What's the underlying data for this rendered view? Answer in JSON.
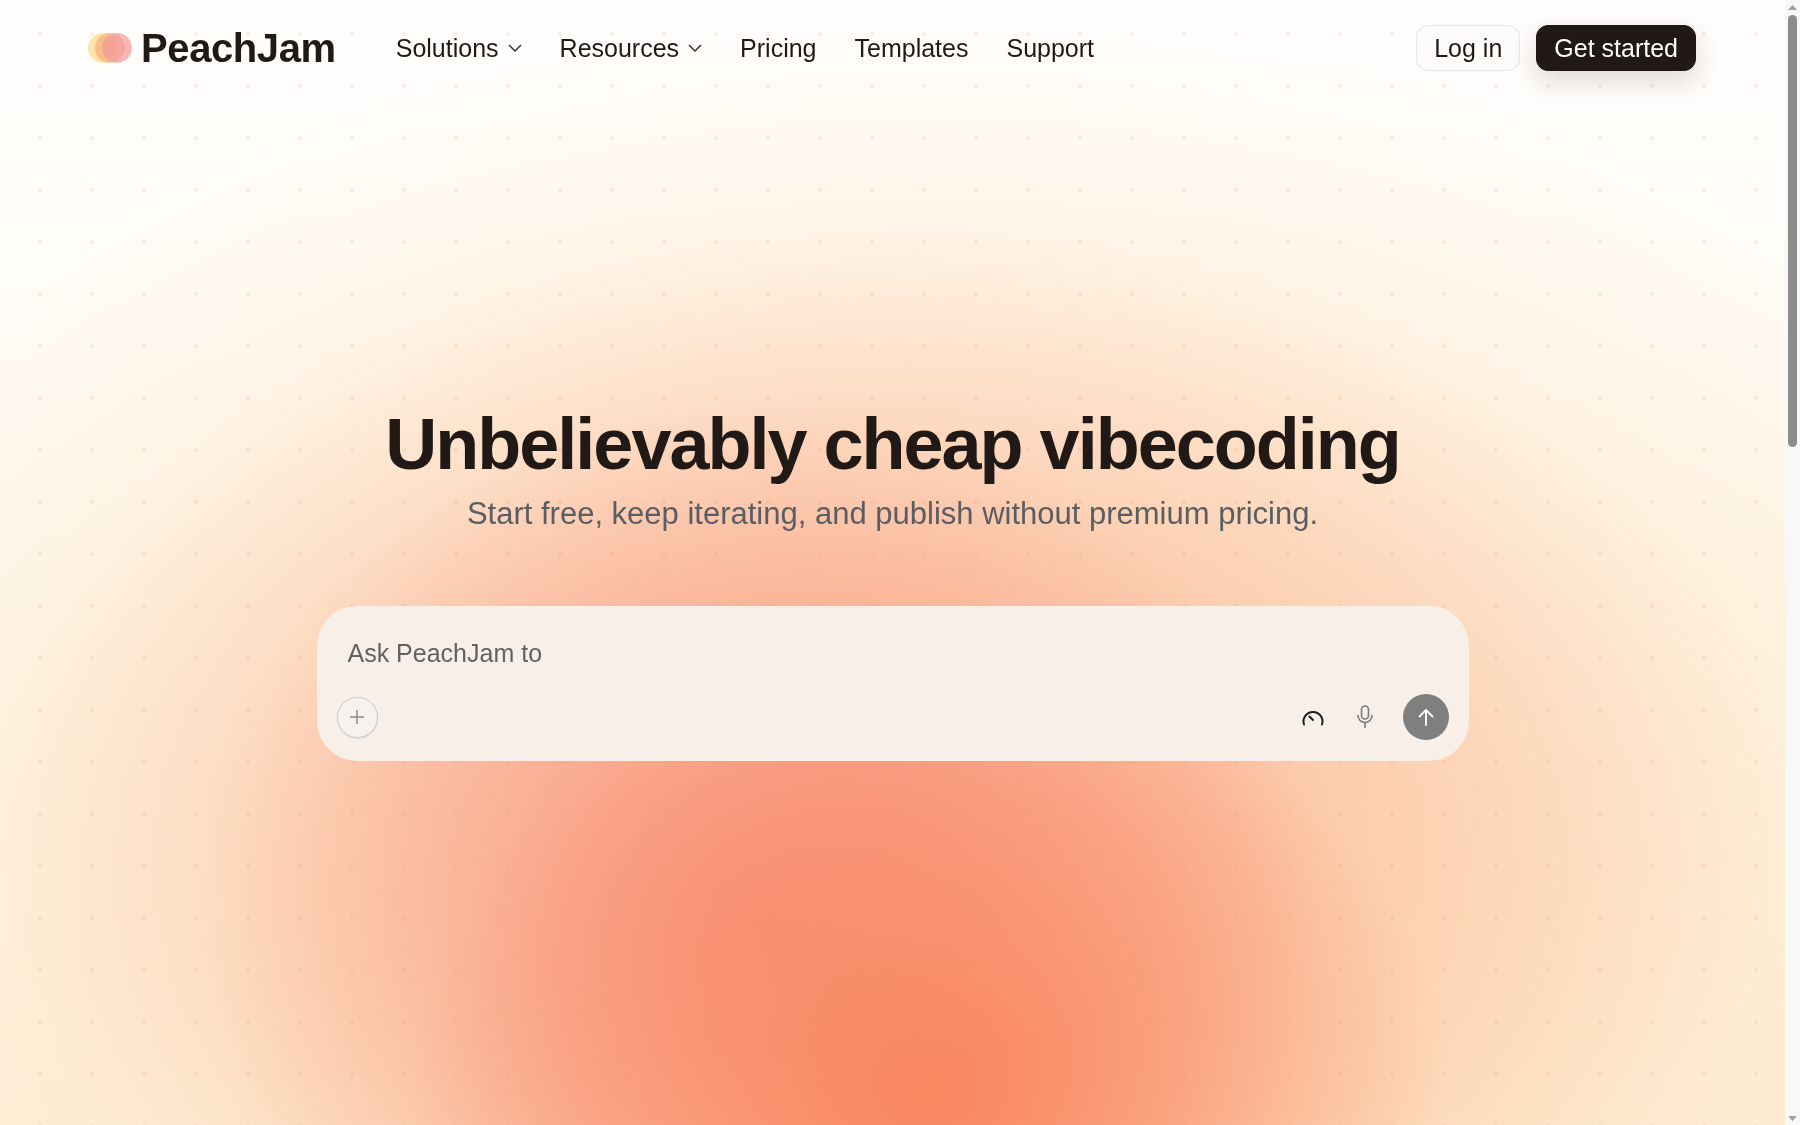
{
  "brand": {
    "name": "PeachJam"
  },
  "nav": {
    "items": [
      {
        "label": "Solutions",
        "kind": "dropdown"
      },
      {
        "label": "Resources",
        "kind": "dropdown"
      },
      {
        "label": "Pricing",
        "kind": "link"
      },
      {
        "label": "Templates",
        "kind": "link"
      },
      {
        "label": "Support",
        "kind": "link"
      }
    ]
  },
  "actions": [
    {
      "label": "Log in",
      "kind": "secondary"
    },
    {
      "label": "Get started",
      "kind": "primary"
    }
  ],
  "hero": {
    "title": "Unbelievably cheap vibecoding",
    "subtitle": "Start free, keep iterating, and publish without premium pricing."
  },
  "prompt": {
    "placeholder": "Ask PeachJam to"
  }
}
